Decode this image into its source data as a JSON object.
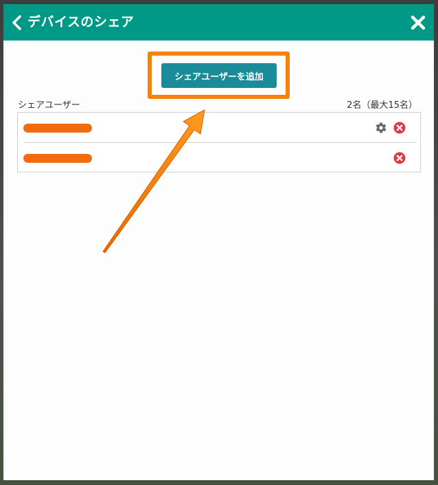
{
  "header": {
    "title": "デバイスのシェア",
    "back_icon": "chevron-left-icon",
    "close_icon": "close-icon"
  },
  "actions": {
    "add_user_label": "シェアユーザーを追加"
  },
  "share_users": {
    "label": "シェアユーザー",
    "count_text": "2名（最大15名）",
    "users": [
      {
        "name": "",
        "has_settings": true,
        "has_delete": true
      },
      {
        "name": "",
        "has_settings": false,
        "has_delete": true
      }
    ]
  },
  "colors": {
    "header_bg": "#009887",
    "button_bg": "#1a8c99",
    "highlight": "#f5820d",
    "delete_red": "#e03a3e",
    "gear_gray": "#666666"
  }
}
